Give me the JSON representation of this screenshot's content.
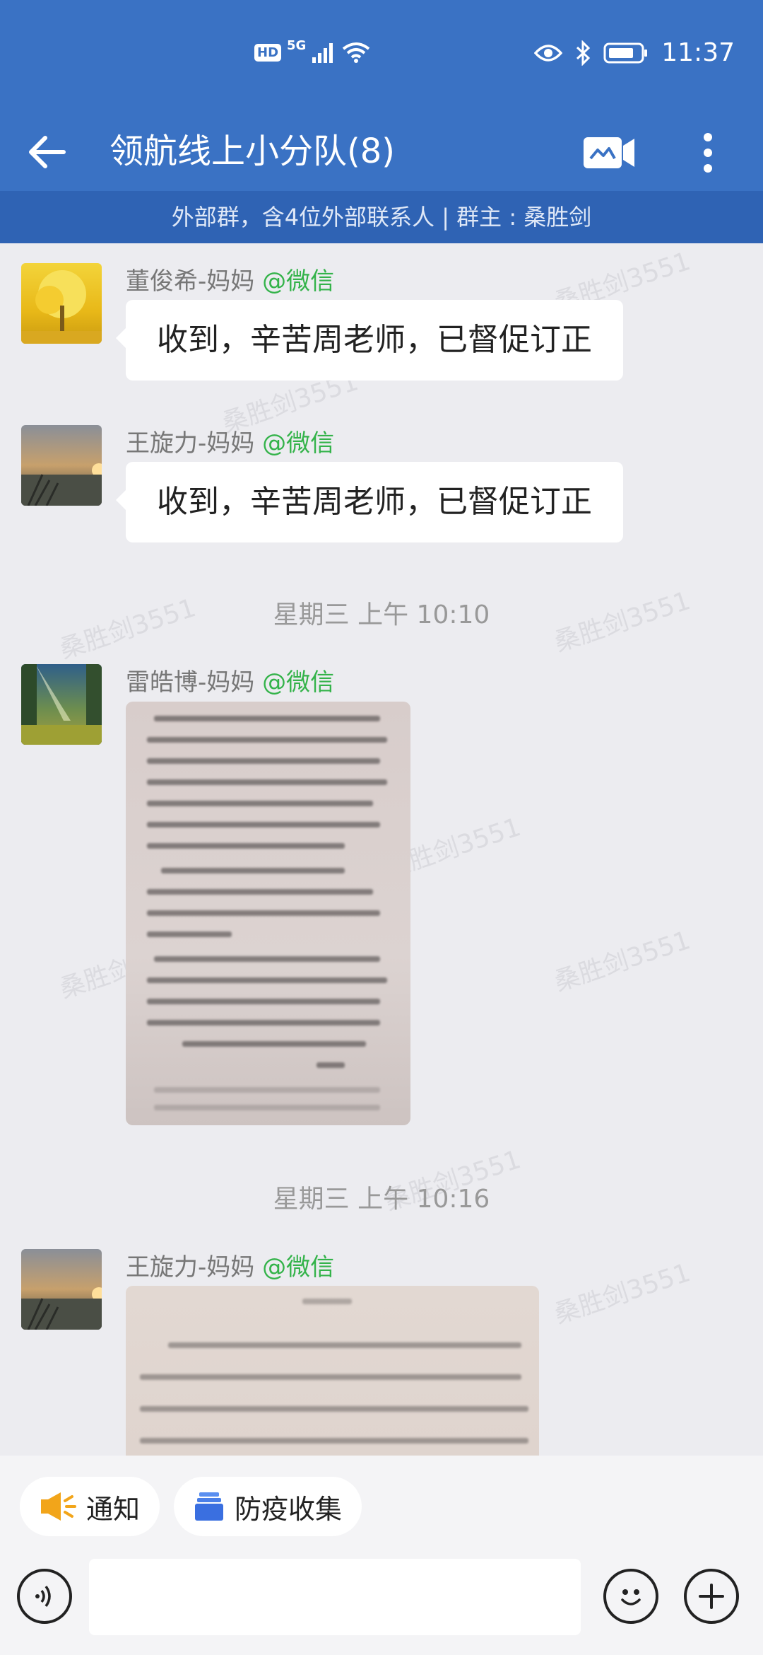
{
  "status_bar": {
    "hd_badge": "HD",
    "network": "5G",
    "time": "11:37",
    "icons": [
      "signal-icon",
      "wifi-icon",
      "eye-icon",
      "bluetooth-icon",
      "battery-icon"
    ]
  },
  "header": {
    "title": "领航线上小分队(8)",
    "back_icon": "back-arrow-icon",
    "video_icon": "video-call-icon",
    "more_icon": "more-vertical-icon"
  },
  "group_info": "外部群，含4位外部联系人 | 群主 : 桑胜剑",
  "watermark": "桑胜剑3551",
  "messages": [
    {
      "sender": "董俊希-妈妈",
      "tag": "@微信",
      "text": "收到，辛苦周老师，已督促订正"
    },
    {
      "sender": "王旋力-妈妈",
      "tag": "@微信",
      "text": "收到，辛苦周老师，已督促订正"
    },
    {
      "timestamp": "星期三  上午 10:10"
    },
    {
      "sender": "雷皓博-妈妈",
      "tag": "@微信",
      "type": "image"
    },
    {
      "timestamp": "星期三  上午 10:16"
    },
    {
      "sender": "王旋力-妈妈",
      "tag": "@微信",
      "type": "image"
    }
  ],
  "quick_actions": [
    {
      "label": "通知",
      "icon": "megaphone-icon"
    },
    {
      "label": "防疫收集",
      "icon": "stack-icon"
    }
  ],
  "input": {
    "placeholder": "",
    "voice_icon": "voice-icon",
    "emoji_icon": "emoji-icon",
    "plus_icon": "plus-icon"
  },
  "colors": {
    "header_bg": "#3a72c4",
    "infobar_bg": "#2f63b4",
    "chat_bg": "#ececf0",
    "wechat_tag": "#34b34a"
  }
}
